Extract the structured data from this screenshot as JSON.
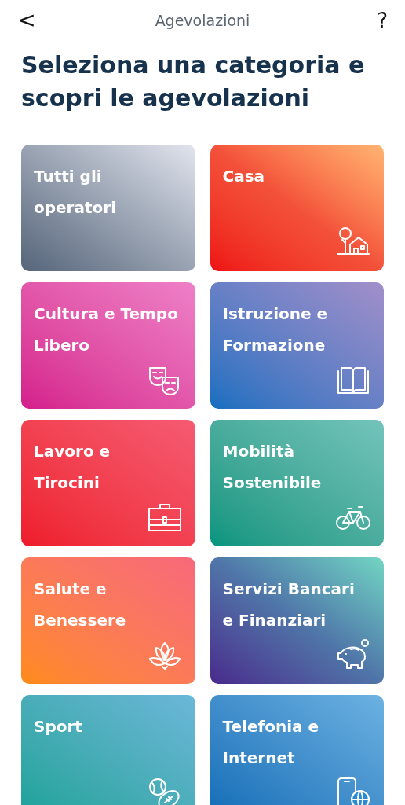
{
  "header": {
    "back": "<",
    "title": "Agevolazioni",
    "help": "?"
  },
  "heading": "Seleziona una categoria e scopri le agevolazioni",
  "categories": [
    {
      "label": "Tutti gli operatori",
      "kind": "all"
    },
    {
      "label": "Casa",
      "kind": "home"
    },
    {
      "label": "Cultura e Tempo Libero",
      "kind": "culture"
    },
    {
      "label": "Istruzione e Formazione",
      "kind": "education"
    },
    {
      "label": "Lavoro e Tirocini",
      "kind": "work"
    },
    {
      "label": "Mobilità Sostenibile",
      "kind": "mobility"
    },
    {
      "label": "Salute e Benessere",
      "kind": "health"
    },
    {
      "label": "Servizi Bancari e Finanziari",
      "kind": "banking"
    },
    {
      "label": "Sport",
      "kind": "sport"
    },
    {
      "label": "Telefonia e Internet",
      "kind": "telecom"
    }
  ]
}
